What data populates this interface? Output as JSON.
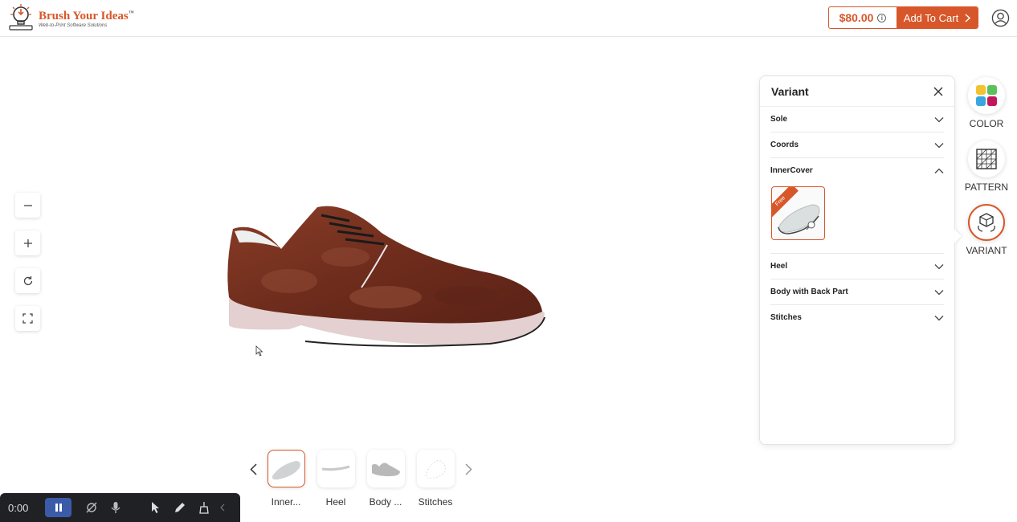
{
  "header": {
    "brand_name": "Brush Your Ideas",
    "brand_tm": "™",
    "brand_tagline": "Web-to-Print Software Solutions",
    "price": "$80.00",
    "add_to_cart_label": "Add To Cart"
  },
  "colors": {
    "accent": "#d8572a",
    "shoe_leather": "#7a3220",
    "sole": "#e6d3d3"
  },
  "panel": {
    "title": "Variant",
    "sections": [
      {
        "label": "Sole",
        "expanded": false
      },
      {
        "label": "Coords",
        "expanded": false
      },
      {
        "label": "InnerCover",
        "expanded": true,
        "option_badge": "Free"
      },
      {
        "label": "Heel",
        "expanded": false
      },
      {
        "label": "Body with Back Part",
        "expanded": false
      },
      {
        "label": "Stitches",
        "expanded": false
      }
    ]
  },
  "side_tools": [
    {
      "label": "COLOR",
      "icon": "color-swatch-icon",
      "active": false
    },
    {
      "label": "PATTERN",
      "icon": "pattern-grid-icon",
      "active": false
    },
    {
      "label": "VARIANT",
      "icon": "variant-cubes-icon",
      "active": true
    }
  ],
  "parts": [
    {
      "label": "Inner...",
      "active": true
    },
    {
      "label": "Heel",
      "active": false
    },
    {
      "label": "Body ...",
      "active": false
    },
    {
      "label": "Stitches",
      "active": false
    }
  ],
  "recorder": {
    "time": "0:00"
  }
}
